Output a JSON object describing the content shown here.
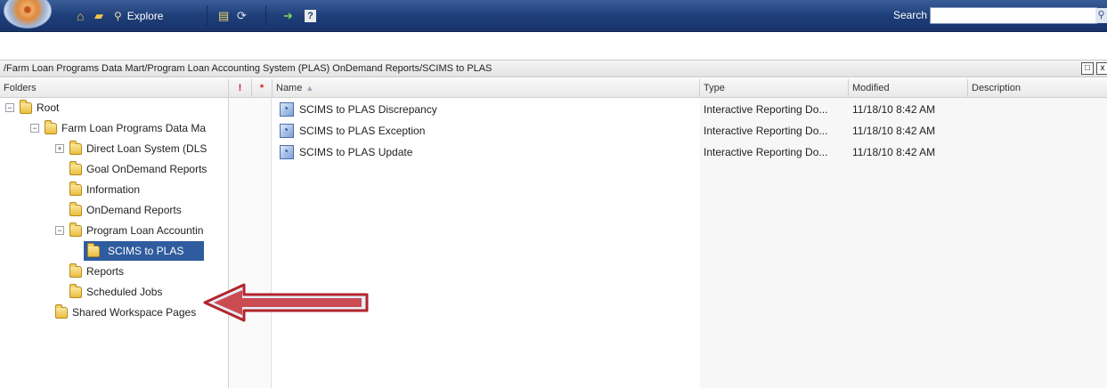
{
  "toolbar": {
    "explore_label": "Explore",
    "search_label": "Search",
    "search_value": ""
  },
  "path": "/Farm Loan Programs Data Mart/Program Loan Accounting System (PLAS) OnDemand Reports/SCIMS to PLAS",
  "columns": {
    "folders": "Folders",
    "flag": "!",
    "required": "*",
    "name": "Name",
    "type": "Type",
    "modified": "Modified",
    "description": "Description"
  },
  "tree": [
    {
      "label": "Root",
      "expander": "−"
    },
    {
      "label": "Farm Loan Programs Data Ma",
      "expander": "−"
    },
    {
      "label": "Direct Loan System (DLS",
      "expander": "+"
    },
    {
      "label": "Goal OnDemand Reports",
      "expander": ""
    },
    {
      "label": "Information",
      "expander": ""
    },
    {
      "label": "OnDemand Reports",
      "expander": ""
    },
    {
      "label": "Program Loan Accountin",
      "expander": "−"
    },
    {
      "label": "SCIMS to PLAS",
      "expander": ""
    },
    {
      "label": "Reports",
      "expander": ""
    },
    {
      "label": "Scheduled Jobs",
      "expander": ""
    },
    {
      "label": "Shared Workspace Pages",
      "expander": ""
    }
  ],
  "files": [
    {
      "name": "SCIMS to PLAS Discrepancy",
      "type": "Interactive Reporting Do...",
      "modified": "11/18/10 8:42 AM",
      "description": ""
    },
    {
      "name": "SCIMS to PLAS Exception",
      "type": "Interactive Reporting Do...",
      "modified": "11/18/10 8:42 AM",
      "description": ""
    },
    {
      "name": "SCIMS to PLAS Update",
      "type": "Interactive Reporting Do...",
      "modified": "11/18/10 8:42 AM",
      "description": ""
    }
  ],
  "colors": {
    "toolbar": "#1f3f7a",
    "selection": "#2f5c9e",
    "flag": "#d21b1b",
    "arrow_fill": "#e4edf8",
    "arrow_stroke": "#b3242a"
  }
}
